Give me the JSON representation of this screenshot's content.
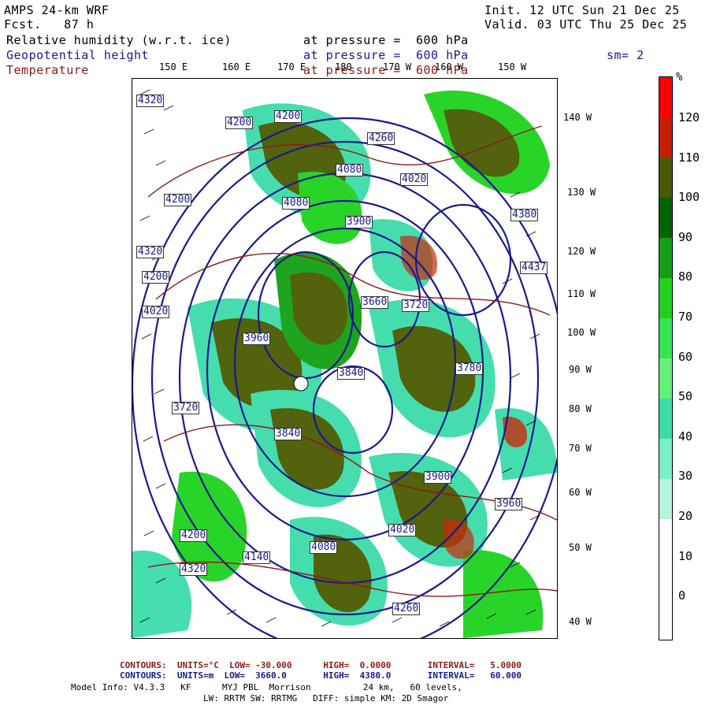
{
  "header": {
    "model": "AMPS 24-km WRF",
    "fcst": "Fcst.   87 h",
    "init": "Init. 12 UTC Sun 21 Dec 25",
    "valid": "Valid. 03 UTC Thu 25 Dec 25"
  },
  "fields": [
    {
      "name": "Relative humidity (w.r.t. ice)",
      "pressure": "at pressure =  600 hPa",
      "color": "#000000"
    },
    {
      "name": "Geopotential height",
      "pressure": "at pressure =  600 hPa",
      "color": "#1a1a8c"
    },
    {
      "name": "Temperature",
      "pressure": "at pressure =  600 hPa",
      "color": "#8b1a1a"
    }
  ],
  "smoothing": "sm= 2",
  "top_lon_labels": [
    "150 E",
    "160 E",
    "170 E",
    "180",
    "170 W",
    "160 W",
    "150 W"
  ],
  "right_lon_labels": [
    "140 W",
    "130 W",
    "120 W",
    "110 W",
    "100 W",
    "90 W",
    "80 W",
    "70 W",
    "60 W",
    "50 W",
    "40 W"
  ],
  "colorbar": {
    "unit": "%",
    "ticks": [
      "120",
      "110",
      "100",
      "90",
      "80",
      "70",
      "60",
      "50",
      "40",
      "30",
      "20",
      "10",
      "0"
    ],
    "colors": [
      "#ff0000",
      "#c81e00",
      "#4a5a00",
      "#006400",
      "#12a012",
      "#1ed21e",
      "#32e650",
      "#64f078",
      "#3cdcaa",
      "#78f0c8",
      "#b4f5dc",
      "#ffffff",
      "#ffffff",
      "#ffffff"
    ]
  },
  "height_labels": [
    "4320",
    "4200",
    "4200",
    "4260",
    "4080",
    "4020",
    "4200",
    "4320",
    "4200",
    "4020",
    "4080",
    "3900",
    "3960",
    "3840",
    "3720",
    "3660",
    "3720",
    "3780",
    "3840",
    "3900",
    "3960",
    "4020",
    "4080",
    "4140",
    "4200",
    "4260",
    "4320",
    "4380",
    "4437"
  ],
  "footer": {
    "temp_line": "CONTOURS:  UNITS=°C  LOW= -30.000      HIGH=  0.0000       INTERVAL=   5.0000",
    "height_line": "CONTOURS:  UNITS=m  LOW=  3660.0       HIGH=  4380.0       INTERVAL=   60.000",
    "model_info": "Model Info: V4.3.3   KF      MYJ PBL  Morrison          24 km,   60 levels,",
    "model_info2": "LW: RRTM SW: RRTMG   DIFF: simple KM: 2D Smagor"
  }
}
